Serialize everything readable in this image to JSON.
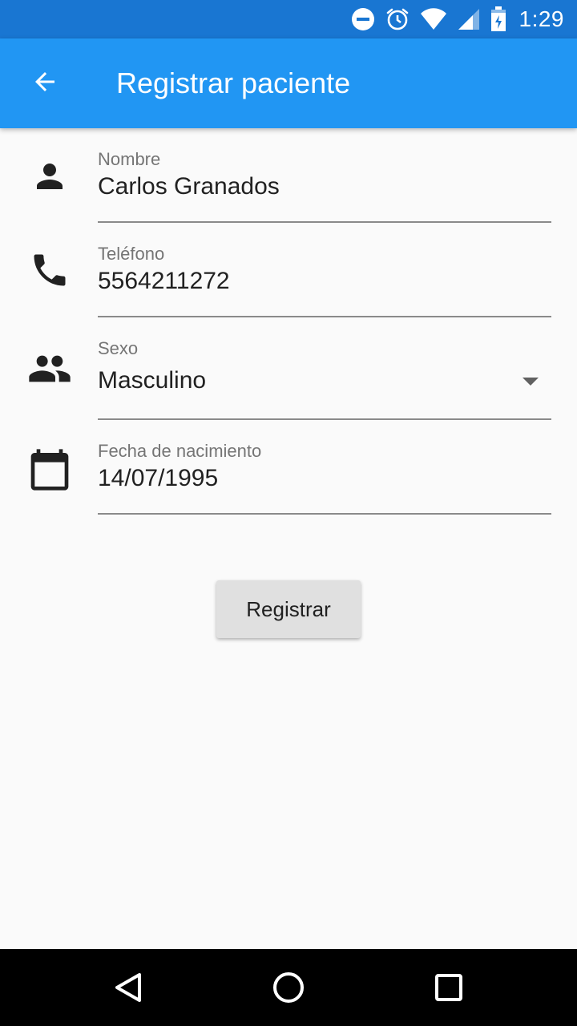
{
  "status_bar": {
    "time": "1:29",
    "icons": [
      "do-not-disturb-icon",
      "alarm-icon",
      "wifi-icon",
      "signal-icon",
      "battery-icon"
    ]
  },
  "app_bar": {
    "title": "Registrar paciente",
    "back_icon": "arrow-back-icon",
    "background": "#2196f3",
    "status_background": "#1976d2"
  },
  "form": {
    "name": {
      "label": "Nombre",
      "value": "Carlos Granados",
      "icon": "person-icon"
    },
    "phone": {
      "label": "Teléfono",
      "value": "5564211272",
      "icon": "phone-icon"
    },
    "sex": {
      "label": "Sexo",
      "value": "Masculino",
      "icon": "people-icon"
    },
    "birthdate": {
      "label": "Fecha de nacimiento",
      "value": "14/07/1995",
      "icon": "calendar-icon"
    }
  },
  "actions": {
    "register_label": "Registrar"
  },
  "nav_bar": {
    "icons": [
      "back-triangle-icon",
      "home-circle-icon",
      "recents-square-icon"
    ]
  }
}
